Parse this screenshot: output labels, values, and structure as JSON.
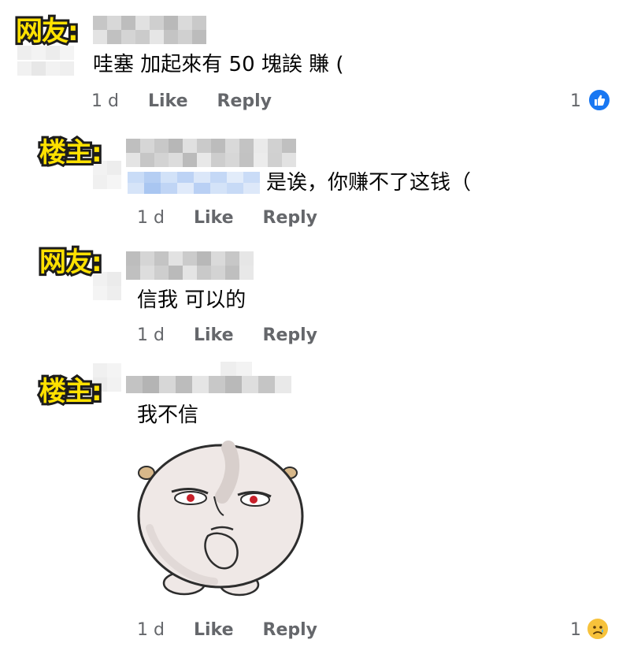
{
  "comments": [
    {
      "tag": "网友:",
      "text": "哇塞 加起來有 50 塊誒 賺 (",
      "time": "1 d",
      "like": "Like",
      "reply": "Reply",
      "reaction_count": "1",
      "reaction": "like-icon"
    },
    {
      "tag": "楼主:",
      "text": "是诶，你赚不了这钱（",
      "time": "1 d",
      "like": "Like",
      "reply": "Reply"
    },
    {
      "tag": "网友:",
      "text": "信我 可以的",
      "time": "1 d",
      "like": "Like",
      "reply": "Reply"
    },
    {
      "tag": "楼主:",
      "text": "我不信",
      "time": "1 d",
      "like": "Like",
      "reply": "Reply",
      "reaction_count": "1",
      "reaction": "sad-reaction-icon",
      "sticker": "skeptical-blob-sticker"
    }
  ],
  "colors": {
    "tag_fill": "#ffe100",
    "tag_stroke": "#1c1c1c",
    "meta_text": "#65676b",
    "like_blue": "#1877f2"
  }
}
